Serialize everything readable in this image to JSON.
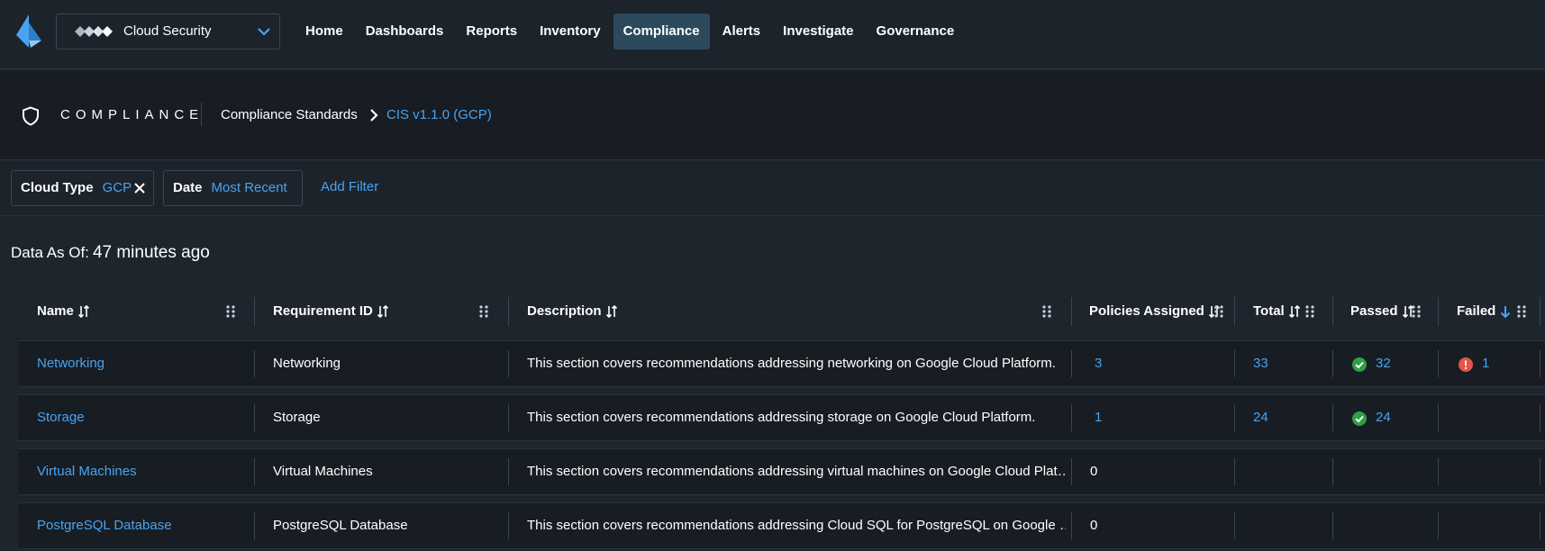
{
  "app": {
    "switcher_label": "Cloud Security"
  },
  "nav": {
    "items": [
      "Home",
      "Dashboards",
      "Reports",
      "Inventory",
      "Compliance",
      "Alerts",
      "Investigate",
      "Governance"
    ],
    "active": "Compliance"
  },
  "header": {
    "section": "COMPLIANCE",
    "breadcrumb_parent": "Compliance Standards",
    "breadcrumb_current": "CIS v1.1.0 (GCP)"
  },
  "filters": {
    "cloud_type_label": "Cloud Type",
    "cloud_type_value": "GCP",
    "date_label": "Date",
    "date_value": "Most Recent",
    "add_filter": "Add Filter"
  },
  "asof": {
    "label": "Data As Of:",
    "value": "47 minutes ago"
  },
  "table": {
    "columns": [
      "Name",
      "Requirement ID",
      "Description",
      "Policies Assigned",
      "Total",
      "Passed",
      "Failed"
    ],
    "rows": [
      {
        "name": "Networking",
        "requirement_id": "Networking",
        "description": "This section covers recommendations addressing networking on Google Cloud Platform.",
        "policies_assigned": "3",
        "total": "33",
        "passed": "32",
        "failed": "1"
      },
      {
        "name": "Storage",
        "requirement_id": "Storage",
        "description": "This section covers recommendations addressing storage on Google Cloud Platform.",
        "policies_assigned": "1",
        "total": "24",
        "passed": "24",
        "failed": ""
      },
      {
        "name": "Virtual Machines",
        "requirement_id": "Virtual Machines",
        "description": "This section covers recommendations addressing virtual machines on Google Cloud Plat…",
        "policies_assigned": "0",
        "total": "",
        "passed": "",
        "failed": ""
      },
      {
        "name": "PostgreSQL Database",
        "requirement_id": "PostgreSQL Database",
        "description": "This section covers recommendations addressing Cloud SQL for PostgreSQL on Google …",
        "policies_assigned": "0",
        "total": "",
        "passed": "",
        "failed": ""
      }
    ]
  },
  "colors": {
    "accent": "#4aa3f0",
    "pass": "#2ea043",
    "fail": "#e5534b",
    "nav_active": "#2c4a5c"
  }
}
